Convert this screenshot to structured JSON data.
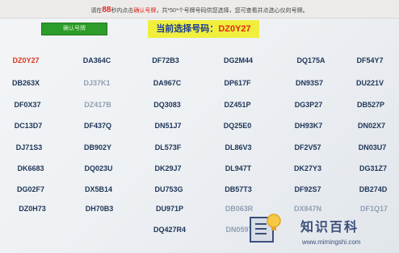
{
  "notice": {
    "prefix": "请在",
    "seconds": "88",
    "middle": "秒内点击",
    "action": "确认号牌",
    "suffix": "，共*50*个号牌号码供您选择，您可查看并点选心仪的号牌。"
  },
  "confirm_button": "确认号牌",
  "current": {
    "label": "当前选择号码：",
    "value": "DZ0Y27"
  },
  "plates": [
    "DZ0Y27",
    "DA364C",
    "DF72B3",
    "DG2M44",
    "DQ175A",
    "DF54Y7",
    "DB263X",
    "DJ37K1",
    "DA967C",
    "DP617F",
    "DN93S7",
    "DU221V",
    "DF0X37",
    "DZ417B",
    "DQ3083",
    "DZ451P",
    "DG3P27",
    "DB527P",
    "DC13D7",
    "DF437Q",
    "DN51J7",
    "DQ25E0",
    "DH93K7",
    "DN02X7",
    "DJ71S3",
    "DB902Y",
    "DL573F",
    "DL86V3",
    "DF2V57",
    "DN03U7",
    "DK6683",
    "DQ023U",
    "DK29J7",
    "DL947T",
    "DK27Y3",
    "DG31Z7",
    "DG02F7",
    "DX5B14",
    "DU753G",
    "DB57T3",
    "DF92S7",
    "DB274D",
    "DZ0H73",
    "DH70B3",
    "DU971P",
    "DB063R",
    "DX847N",
    "DF1Q17",
    "DQ427R4",
    "DN0597"
  ],
  "selected": "DZ0Y27",
  "watermark": {
    "title": "知识百科",
    "url": "www.mimingshi.com"
  },
  "colors": {
    "accent_red": "#e1251b",
    "current_bg": "#f0ef3e",
    "button_green": "#2d9c2a",
    "plate_text": "#1d3457"
  }
}
